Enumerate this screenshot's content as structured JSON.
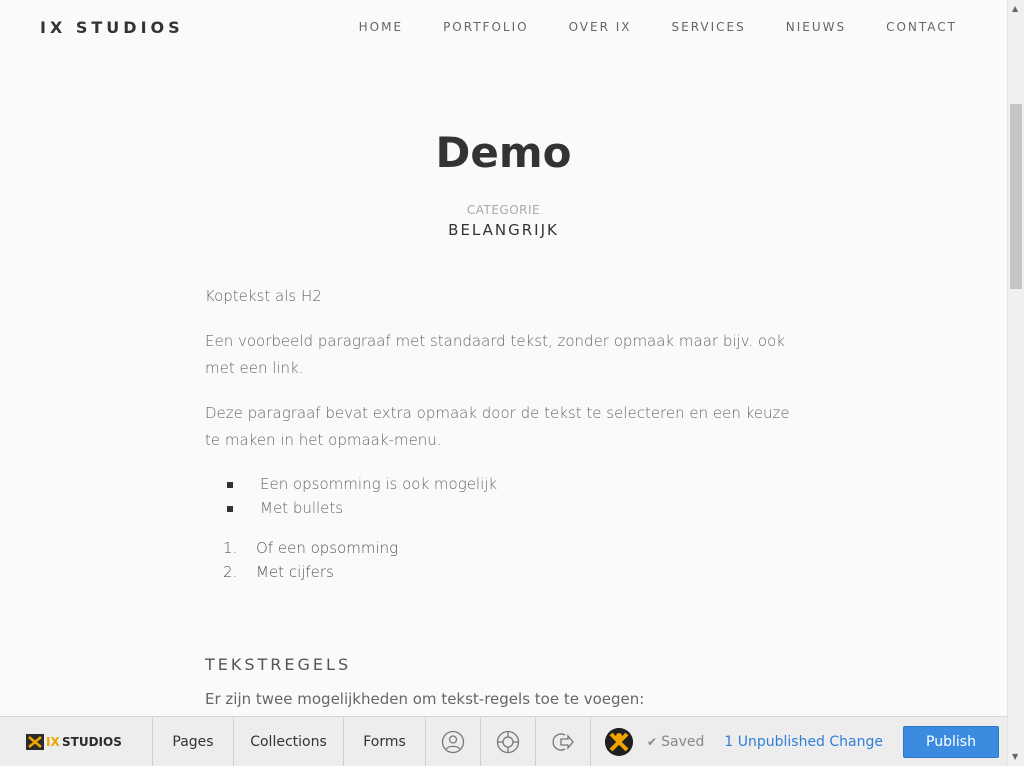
{
  "header": {
    "brand": "IX STUDIOS",
    "nav": [
      "HOME",
      "PORTFOLIO",
      "OVER IX",
      "SERVICES",
      "NIEUWS",
      "CONTACT"
    ]
  },
  "article": {
    "title": "Demo",
    "category_label": "CATEGORIE",
    "category_value": "BELANGRIJK",
    "heading_h2": "Koptekst als H2",
    "paragraph1": "Een voorbeeld paragraaf met standaard tekst, zonder opmaak maar bijv. ook met een link.",
    "paragraph2": "Deze paragraaf bevat extra opmaak door de tekst te selecteren en een keuze te maken in het opmaak-menu.",
    "bullets": [
      "Een opsomming is ook mogelijk",
      "Met bullets"
    ],
    "numbered": [
      {
        "num": "1.",
        "text": "Of een opsomming"
      },
      {
        "num": "2.",
        "text": "Met cijfers"
      }
    ],
    "section_heading": "TEKSTREGELS",
    "section_paragraph": "Er zijn twee mogelijkheden om tekst-regels toe te voegen:"
  },
  "editor_bar": {
    "logo_text": "IXSTUDIOS",
    "pages": "Pages",
    "collections": "Collections",
    "forms": "Forms",
    "icons": [
      "user-icon",
      "help-lifebuoy-icon",
      "exit-icon"
    ],
    "saved": "Saved",
    "unpublished": "1 Unpublished Change",
    "publish": "Publish",
    "accent": "#3b8be0"
  }
}
